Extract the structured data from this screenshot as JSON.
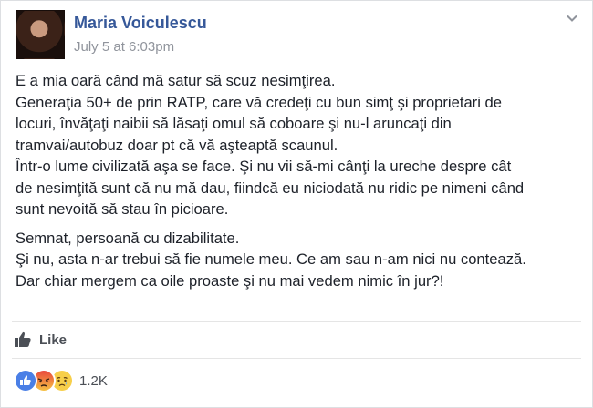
{
  "post": {
    "author": "Maria Voiculescu",
    "timestamp": "July 5 at 6:03pm",
    "paragraphs": [
      [
        "E a mia oară când mă satur să scuz nesimţirea.",
        "Generaţia 50+ de prin RATP, care vă credeţi cu bun simţ şi proprietari de",
        "locuri, învăţaţi naibii să lăsaţi omul să coboare şi nu-l aruncaţi din",
        "tramvai/autobuz doar pt că vă aşteaptă scaunul.",
        "Într-o lume civilizată aşa se face. Şi nu vii să-mi cânţi la ureche despre cât",
        "de nesimţită sunt că nu mă dau, fiindcă eu niciodată nu ridic pe nimeni când",
        "sunt nevoită să stau în picioare."
      ],
      [
        "Semnat, persoană cu dizabilitate.",
        "Şi nu, asta n-ar trebui să fie numele meu. Ce am sau n-am nici nu contează.",
        "Dar chiar mergem ca oile proaste şi nu mai vedem nimic în jur?!"
      ]
    ]
  },
  "actions": {
    "like_label": "Like",
    "like_icon": "thumbs-up-icon"
  },
  "reactions": {
    "types": [
      "like",
      "angry",
      "sad"
    ],
    "count": "1.2K"
  },
  "colors": {
    "author": "#365899",
    "meta": "#90949c",
    "like_blue": "#4a7fe6"
  }
}
